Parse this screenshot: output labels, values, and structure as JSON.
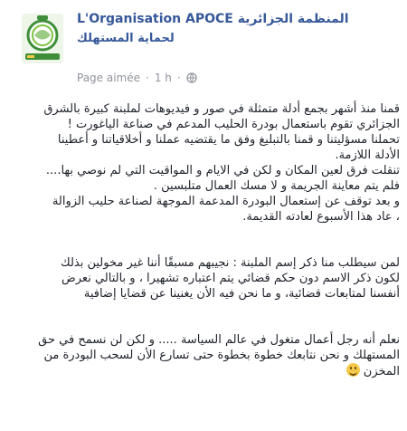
{
  "header": {
    "title_latin": "L'Organisation APOCE",
    "title_arabic": "المنظمة الجزائرية",
    "subtitle_arabic": "لحماية المستهلك",
    "page_liked": "Page aimée",
    "separator": "·",
    "time": "1 h",
    "logo_text": "APOCE",
    "audience_icon": "globe-icon"
  },
  "post": {
    "lines": [
      "قمنا منذ أشهر بجمع أدلة متمثلة في صور و فيديوهات لملبنة كبيرة بالشرق",
      "الجزائري تقوم باستعمال بودرة الحليب المدعم في صناعة الياغورت !",
      "تحملنا مسؤليتنا و قمنا بالتبليغ وفق ما يقتضيه عملنا و أخلاقياتنا و أعطينا",
      "الأدلة اللازمة.",
      "تنقلت فرق لعين المكان و لكن في الايام و المواقيت التي لم نوصي بها....",
      "فلم يتم معاينة الجريمة و لا مسك العمال متلبسين .",
      "و بعد توقف عن إستعمال البودرة المدعمة الموجهة لصناعة حليب الزوالة",
      "، عاد هذا الأسبوع لعادته القديمة.",
      "",
      "",
      "لمن سيطلب منا ذكر إسم الملبنة : نجيبهم مسبقًا أننا غير مخولين بذلك",
      "لكون ذكر الاسم دون حكم قضائي يتم اعتباره تشهيرا ، و بالتالي نعرض",
      "أنفسنا لمتابعات قضائية، و ما نحن فيه الأن يغنينا عن قضايا إضافية",
      "",
      "",
      "نعلم أنه رجل أعمال متغول في عالم السياسة ..... و لكن لن نسمح في حق",
      "المستهلك و نحن نتابعك خطوة بخطوة حتى تسارع الأن لسحب البودرة من",
      "المخزن"
    ],
    "closing_emoji": "smile-emoji"
  }
}
